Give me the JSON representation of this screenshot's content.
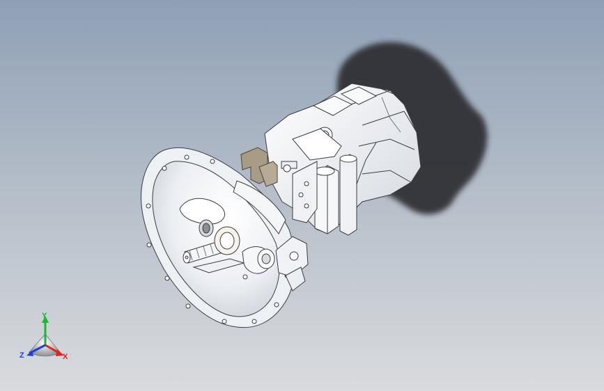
{
  "viewport": {
    "background_top": "#8fa0b6",
    "background_bottom": "#d7dadd",
    "shadow_color": "#2a2a2c",
    "model_color": "#f2f4f7",
    "model_edge_color": "#3a3d42",
    "bracket_color": "#a89c86"
  },
  "triad": {
    "x_label": "X",
    "y_label": "Y",
    "z_label": "Z",
    "x_color": "#e0241e",
    "y_color": "#19b833",
    "z_color": "#1f3fd8"
  }
}
